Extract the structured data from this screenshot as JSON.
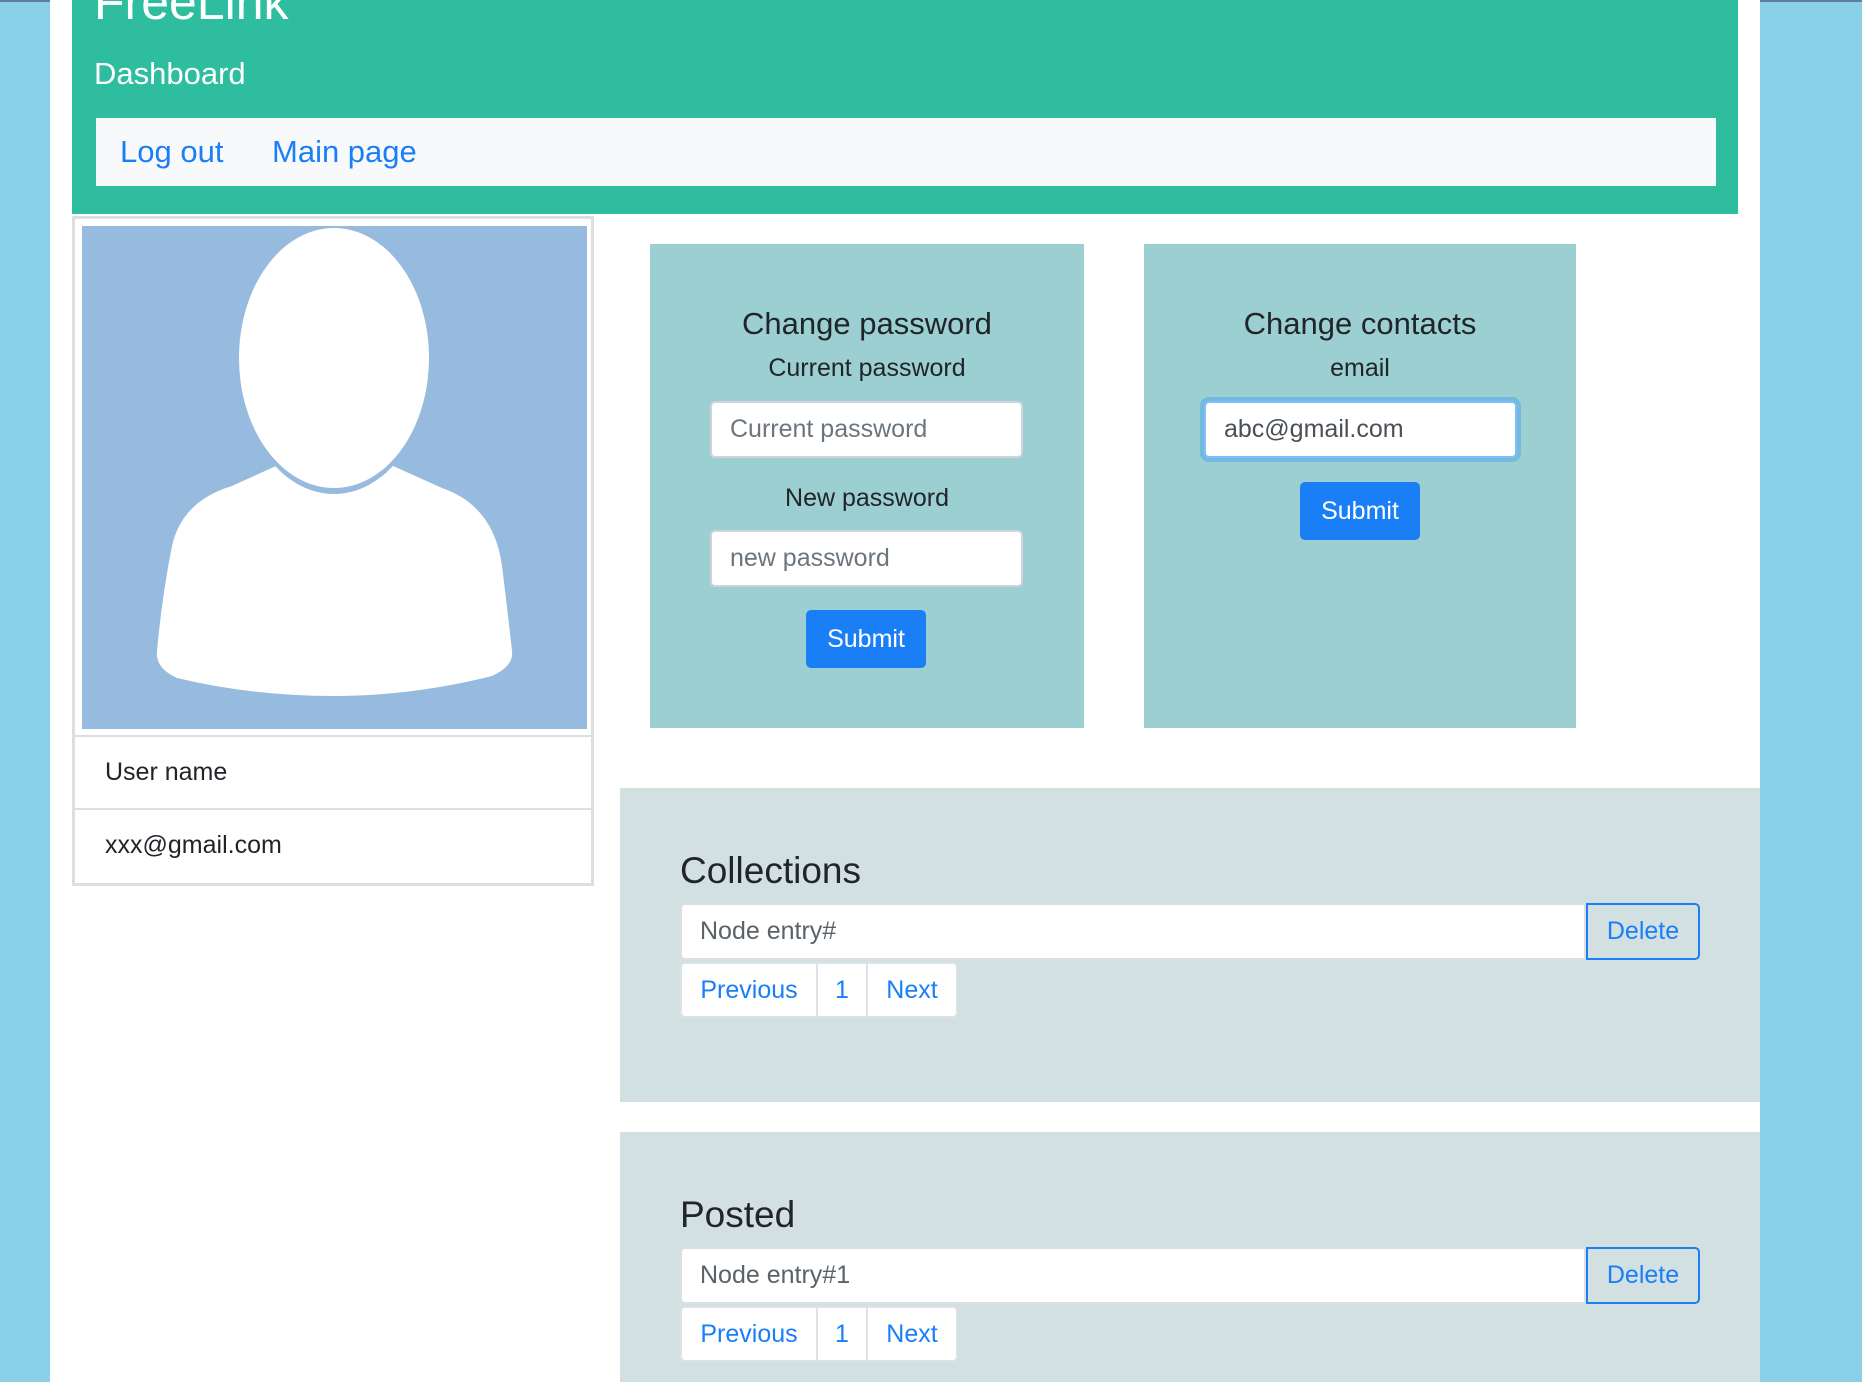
{
  "header": {
    "brand": "FreeLink",
    "subtitle": "Dashboard",
    "nav": {
      "logout": "Log out",
      "main_page": "Main page"
    }
  },
  "profile": {
    "avatar_icon": "user-silhouette-icon",
    "user_name": "User name",
    "email": "xxx@gmail.com"
  },
  "change_password": {
    "title": "Change password",
    "current_label": "Current password",
    "current_placeholder": "Current password",
    "current_value": "",
    "new_label": "New password",
    "new_placeholder": "new password",
    "new_value": "",
    "submit_label": "Submit"
  },
  "change_contacts": {
    "title": "Change contacts",
    "email_label": "email",
    "email_value": "abc@gmail.com",
    "submit_label": "Submit"
  },
  "collections": {
    "title": "Collections",
    "entry": "Node entry#",
    "delete_label": "Delete",
    "pagination": {
      "previous": "Previous",
      "page": "1",
      "next": "Next"
    }
  },
  "posted": {
    "title": "Posted",
    "entry": "Node entry#1",
    "delete_label": "Delete",
    "pagination": {
      "previous": "Previous",
      "page": "1",
      "next": "Next"
    }
  },
  "colors": {
    "page_background": "#88cfe8",
    "header": "#2ebd9e",
    "navbar": "#f8f9fa",
    "avatar_background": "#97bbdf",
    "settings_panel": "#9bcfd1",
    "section_background": "#d2e0e2",
    "primary": "#1a7ff7"
  }
}
